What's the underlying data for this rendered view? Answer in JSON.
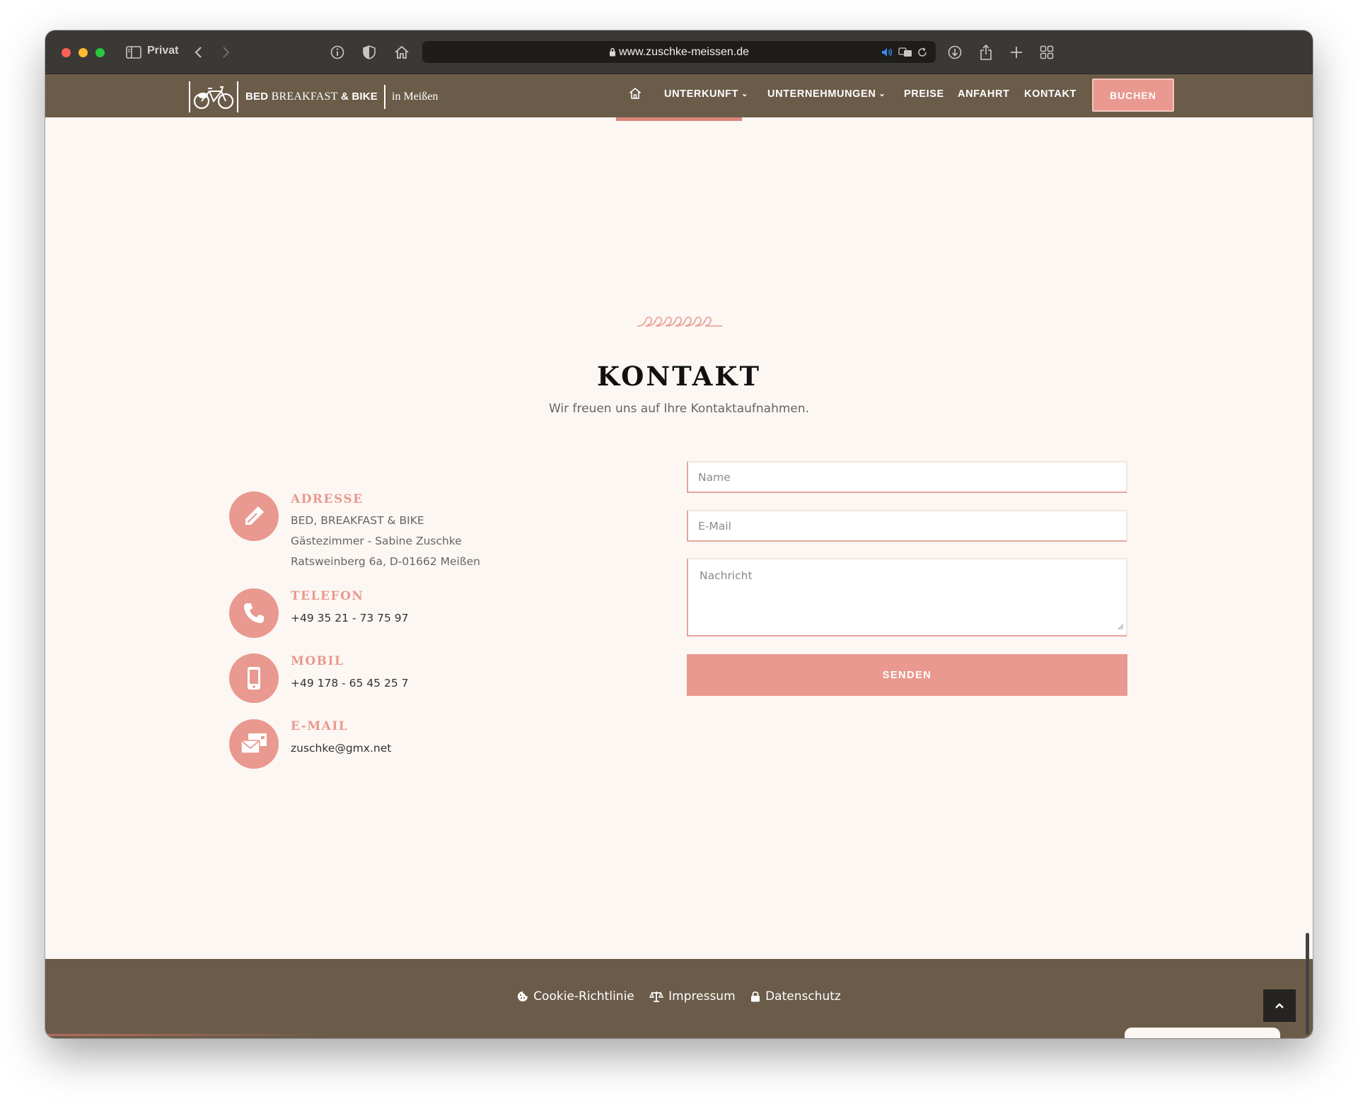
{
  "browser": {
    "private_label": "Privat",
    "url": "www.zuschke-meissen.de"
  },
  "header": {
    "logo": {
      "name": "BED BREAKFAST & BIKE",
      "name_part1": "BED ",
      "name_part2": "BREAKFAST",
      "name_part3": " & BIKE",
      "city": "in Meißen"
    },
    "nav": [
      {
        "label": "UNTERKUNFT",
        "has_dropdown": true
      },
      {
        "label": "UNTERNEHMUNGEN",
        "has_dropdown": true
      },
      {
        "label": "PREISE",
        "has_dropdown": false
      },
      {
        "label": "ANFAHRT",
        "has_dropdown": false
      },
      {
        "label": "KONTAKT",
        "has_dropdown": false
      }
    ],
    "cta_label": "BUCHEN"
  },
  "contact": {
    "title": "KONTAKT",
    "subtitle": "Wir freuen uns auf Ihre Kontaktaufnahmen.",
    "items": [
      {
        "icon": "pen-icon",
        "title": "ADRESSE",
        "lines": [
          "BED, BREAKFAST & BIKE",
          "Gästezimmer - Sabine Zuschke",
          "Ratsweinberg 6a, D-01662 Meißen"
        ]
      },
      {
        "icon": "phone-icon",
        "title": "TELEFON",
        "lines": [
          "+49 35 21 - 73 75 97"
        ]
      },
      {
        "icon": "mobile-icon",
        "title": "MOBIL",
        "lines": [
          "+49 178 - 65 45 25 7"
        ]
      },
      {
        "icon": "envelope-icon",
        "title": "E-MAIL",
        "lines": [
          "zuschke@gmx.net"
        ]
      }
    ]
  },
  "form": {
    "name_placeholder": "Name",
    "email_placeholder": "E-Mail",
    "message_placeholder": "Nachricht",
    "submit_label": "SENDEN"
  },
  "footer": {
    "links": [
      {
        "icon": "cookie-icon",
        "label": "Cookie-Richtlinie"
      },
      {
        "icon": "scale-icon",
        "label": "Impressum"
      },
      {
        "icon": "lock-icon",
        "label": "Datenschutz"
      }
    ]
  },
  "colors": {
    "accent": "#e9998f",
    "header_bg": "#6b5c49",
    "page_bg": "#fcf7f3"
  }
}
